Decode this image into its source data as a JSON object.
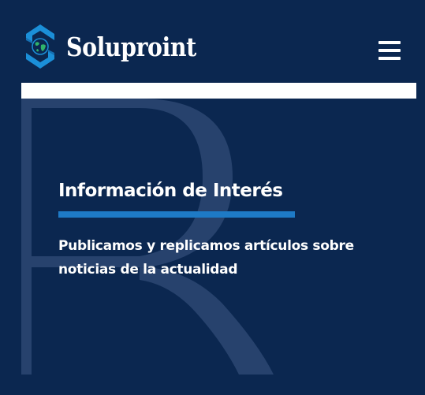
{
  "header": {
    "brand_name": "Soluproint",
    "logo_icon": "soluproint-logo-icon",
    "menu_icon": "hamburger-menu-icon"
  },
  "hero": {
    "title": "Información de Interés",
    "description": "Publicamos y replicamos artículos sobre noticias de la actualidad",
    "watermark_icon": "letter-r-watermark-icon"
  },
  "colors": {
    "background": "#0b2750",
    "accent": "#1e7ac6",
    "logo_blue": "#1b8fd8",
    "globe_green": "#2fb36b",
    "text": "#ffffff"
  }
}
